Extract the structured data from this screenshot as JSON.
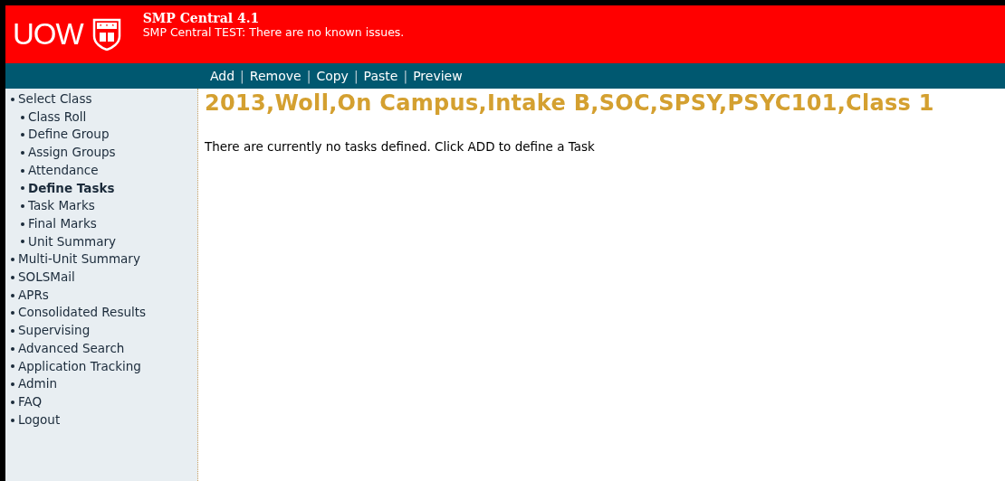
{
  "header": {
    "logo_text": "UOW",
    "title": "SMP Central 4.1",
    "message": "SMP Central TEST: There are no known issues."
  },
  "toolbar": [
    {
      "kind": "link",
      "label": "Add"
    },
    {
      "kind": "separator",
      "label": "|"
    },
    {
      "kind": "link",
      "label": "Remove"
    },
    {
      "kind": "separator",
      "label": "|"
    },
    {
      "kind": "link",
      "label": "Copy"
    },
    {
      "kind": "separator",
      "label": "|"
    },
    {
      "kind": "link",
      "label": "Paste"
    },
    {
      "kind": "separator",
      "label": "|"
    },
    {
      "kind": "link",
      "label": "Preview"
    }
  ],
  "sidebar": {
    "items": [
      {
        "label": "Select Class",
        "selected": false,
        "children": [
          {
            "label": "Class Roll",
            "selected": false
          },
          {
            "label": "Define Group",
            "selected": false
          },
          {
            "label": "Assign Groups",
            "selected": false
          },
          {
            "label": "Attendance",
            "selected": false
          },
          {
            "label": "Define Tasks",
            "selected": true
          },
          {
            "label": "Task Marks",
            "selected": false
          },
          {
            "label": "Final Marks",
            "selected": false
          },
          {
            "label": "Unit Summary",
            "selected": false
          }
        ]
      },
      {
        "label": "Multi-Unit Summary",
        "selected": false
      },
      {
        "label": "SOLSMail",
        "selected": false
      },
      {
        "label": "APRs",
        "selected": false
      },
      {
        "label": "Consolidated Results",
        "selected": false
      },
      {
        "label": "Supervising",
        "selected": false
      },
      {
        "label": "Advanced Search",
        "selected": false
      },
      {
        "label": "Application Tracking",
        "selected": false
      },
      {
        "label": "Admin",
        "selected": false
      },
      {
        "label": "FAQ",
        "selected": false
      },
      {
        "label": "Logout",
        "selected": false
      }
    ]
  },
  "content": {
    "heading": "2013,Woll,On Campus,Intake B,SOC,SPSY,PSYC101,Class 1",
    "message": "There are currently no tasks defined. Click ADD to define a Task"
  }
}
